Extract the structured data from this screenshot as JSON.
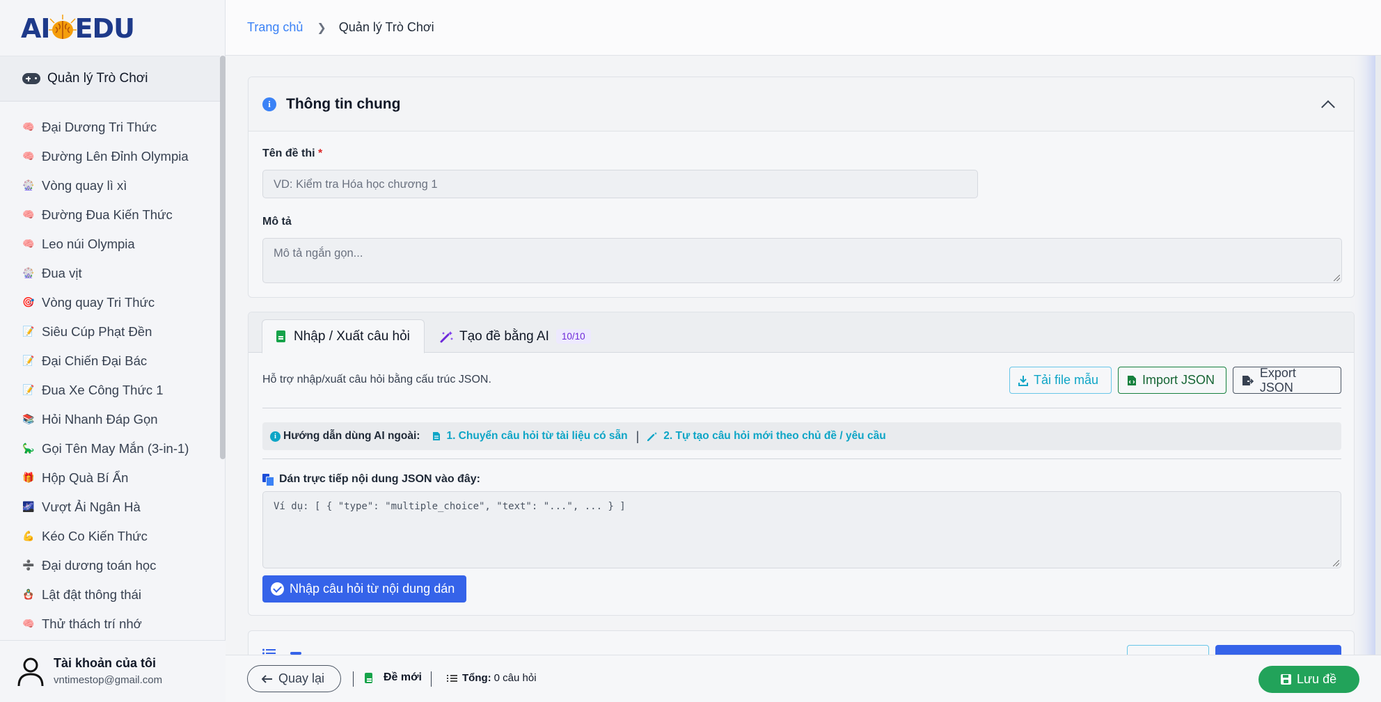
{
  "logo": {
    "text_left": "AI",
    "text_right": "EDU"
  },
  "sidebar": {
    "header": "Quản lý Trò Chơi",
    "items": [
      {
        "label": "Đại Dương Tri Thức",
        "icon": "brain-icon",
        "glyph": "🧠"
      },
      {
        "label": "Đường Lên Đỉnh Olympia",
        "icon": "brain-icon",
        "glyph": "🧠"
      },
      {
        "label": "Vòng quay lì xì",
        "icon": "wheel-icon",
        "glyph": "🎡"
      },
      {
        "label": "Đường Đua Kiến Thức",
        "icon": "brain-icon",
        "glyph": "🧠"
      },
      {
        "label": "Leo núi Olympia",
        "icon": "brain-icon",
        "glyph": "🧠"
      },
      {
        "label": "Đua vịt",
        "icon": "wheel-icon",
        "glyph": "🎡"
      },
      {
        "label": "Vòng quay Tri Thức",
        "icon": "target-icon",
        "glyph": "🎯"
      },
      {
        "label": "Siêu Cúp Phạt Đền",
        "icon": "memo-icon",
        "glyph": "📝"
      },
      {
        "label": "Đại Chiến Đại Bác",
        "icon": "memo-icon",
        "glyph": "📝"
      },
      {
        "label": "Đua Xe Công Thức 1",
        "icon": "memo-icon",
        "glyph": "📝"
      },
      {
        "label": "Hỏi Nhanh Đáp Gọn",
        "icon": "books-icon",
        "glyph": "📚"
      },
      {
        "label": "Gọi Tên May Mắn (3-in-1)",
        "icon": "dinosaur-icon",
        "glyph": "🦕"
      },
      {
        "label": "Hộp Quà Bí Ẩn",
        "icon": "gift-icon",
        "glyph": "🎁"
      },
      {
        "label": "Vượt Ải Ngân Hà",
        "icon": "galaxy-icon",
        "glyph": "🌌"
      },
      {
        "label": "Kéo Co Kiến Thức",
        "icon": "muscle-icon",
        "glyph": "💪"
      },
      {
        "label": "Đại dương toán học",
        "icon": "divide-icon",
        "glyph": "➗"
      },
      {
        "label": "Lật đật thông thái",
        "icon": "doll-icon",
        "glyph": "🪆"
      },
      {
        "label": "Thử thách trí nhớ",
        "icon": "brain-icon",
        "glyph": "🧠"
      }
    ],
    "account": {
      "title": "Tài khoản của tôi",
      "email": "vntimestop@gmail.com"
    }
  },
  "breadcrumb": {
    "home": "Trang chủ",
    "current": "Quản lý Trò Chơi"
  },
  "general": {
    "title": "Thông tin chung",
    "name_label": "Tên đề thi",
    "required_mark": "*",
    "name_placeholder": "VD: Kiểm tra Hóa học chương 1",
    "desc_label": "Mô tả",
    "desc_placeholder": "Mô tả ngắn gọn..."
  },
  "questions": {
    "tab_import": "Nhập / Xuất câu hỏi",
    "tab_ai": "Tạo đề bằng AI",
    "tab_ai_badge": "10/10",
    "help_text": "Hỗ trợ nhập/xuất câu hỏi bằng cấu trúc JSON.",
    "btn_template": "Tải file mẫu",
    "btn_import": "Import JSON",
    "btn_export": "Export JSON",
    "guide_label": "Hướng dẫn dùng AI ngoài:",
    "guide_link1": "1. Chuyển câu hỏi từ tài liệu có sẵn",
    "guide_link2": "2. Tự tạo câu hỏi mới theo chủ đề / yêu cầu",
    "paste_label": "Dán trực tiếp nội dung JSON vào đây:",
    "paste_placeholder": "Ví dụ: [ { \"type\": \"multiple_choice\", \"text\": \"...\", ... } ]",
    "btn_paste": "Nhập câu hỏi từ nội dung dán"
  },
  "footer": {
    "back": "Quay lại",
    "doc_status": "Đề mới",
    "total_label": "Tổng:",
    "total_value": "0 câu hỏi",
    "save": "Lưu đề"
  },
  "colors": {
    "primary": "#3563e9",
    "success": "#22a35a",
    "info": "#0ea5c6",
    "accent_purple": "#6d28d9"
  }
}
